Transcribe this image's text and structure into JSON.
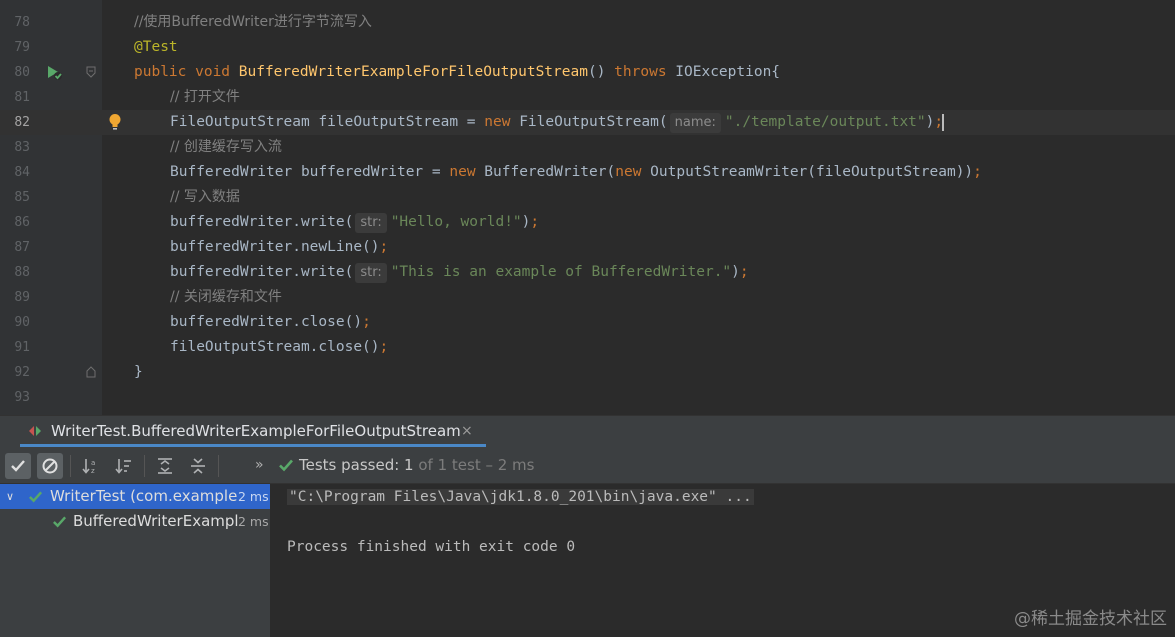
{
  "editor": {
    "lines": [
      {
        "num": "78",
        "parts": [
          {
            "t": "//使用BufferedWriter进行字节流写入",
            "c": "cmt"
          }
        ]
      },
      {
        "num": "79",
        "parts": [
          {
            "t": "@Test",
            "c": "ann"
          }
        ]
      },
      {
        "num": "80",
        "parts": [
          {
            "t": "public void ",
            "c": "kw"
          },
          {
            "t": "BufferedWriterExampleForFileOutputStream",
            "c": "fn"
          },
          {
            "t": "() ",
            "c": ""
          },
          {
            "t": "throws ",
            "c": "kw"
          },
          {
            "t": "IOException{",
            "c": ""
          }
        ]
      },
      {
        "num": "81",
        "parts": [
          {
            "t": "// 打开文件",
            "c": "cmt"
          }
        ]
      },
      {
        "num": "82",
        "parts": [
          {
            "t": "FileOutputStream fileOutputStream = ",
            "c": ""
          },
          {
            "t": "new ",
            "c": "kw"
          },
          {
            "t": "FileOutputStream(",
            "c": ""
          },
          {
            "t": "name:",
            "c": "hint"
          },
          {
            "t": "\"./template/output.txt\"",
            "c": "str"
          },
          {
            "t": ")",
            "c": ""
          },
          {
            "t": ";",
            "c": "kw"
          }
        ]
      },
      {
        "num": "83",
        "parts": [
          {
            "t": "// 创建缓存写入流",
            "c": "cmt"
          }
        ]
      },
      {
        "num": "84",
        "parts": [
          {
            "t": "BufferedWriter bufferedWriter = ",
            "c": ""
          },
          {
            "t": "new ",
            "c": "kw"
          },
          {
            "t": "BufferedWriter(",
            "c": ""
          },
          {
            "t": "new ",
            "c": "kw"
          },
          {
            "t": "OutputStreamWriter(fileOutputStream))",
            "c": ""
          },
          {
            "t": ";",
            "c": "kw"
          }
        ]
      },
      {
        "num": "85",
        "parts": [
          {
            "t": "// 写入数据",
            "c": "cmt"
          }
        ]
      },
      {
        "num": "86",
        "parts": [
          {
            "t": "bufferedWriter.write(",
            "c": ""
          },
          {
            "t": "str:",
            "c": "hint"
          },
          {
            "t": "\"Hello, world!\"",
            "c": "str"
          },
          {
            "t": ")",
            "c": ""
          },
          {
            "t": ";",
            "c": "kw"
          }
        ]
      },
      {
        "num": "87",
        "parts": [
          {
            "t": "bufferedWriter.newLine()",
            "c": ""
          },
          {
            "t": ";",
            "c": "kw"
          }
        ]
      },
      {
        "num": "88",
        "parts": [
          {
            "t": "bufferedWriter.write(",
            "c": ""
          },
          {
            "t": "str:",
            "c": "hint"
          },
          {
            "t": "\"This is an example of BufferedWriter.\"",
            "c": "str"
          },
          {
            "t": ")",
            "c": ""
          },
          {
            "t": ";",
            "c": "kw"
          }
        ]
      },
      {
        "num": "89",
        "parts": [
          {
            "t": "// 关闭缓存和文件",
            "c": "cmt"
          }
        ]
      },
      {
        "num": "90",
        "parts": [
          {
            "t": "bufferedWriter.close()",
            "c": ""
          },
          {
            "t": ";",
            "c": "kw"
          }
        ]
      },
      {
        "num": "91",
        "parts": [
          {
            "t": "fileOutputStream.close()",
            "c": ""
          },
          {
            "t": ";",
            "c": "kw"
          }
        ]
      },
      {
        "num": "92",
        "parts": [
          {
            "t": "}",
            "c": ""
          }
        ]
      },
      {
        "num": "93",
        "parts": []
      }
    ]
  },
  "run_tab": {
    "label": "WriterTest.BufferedWriterExampleForFileOutputStream",
    "close": "×"
  },
  "toolbar": {
    "chevron": "»",
    "status_main": "Tests passed: ",
    "status_count": "1",
    "status_rest": " of 1 test – 2 ms"
  },
  "tree": {
    "root_chevron": "∨",
    "root_name": "WriterTest (com.example",
    "root_time": "2 ms",
    "child_name": "BufferedWriterExampl",
    "child_time": "2 ms"
  },
  "console": {
    "command": "\"C:\\Program Files\\Java\\jdk1.8.0_201\\bin\\java.exe\" ...",
    "exit": "Process finished with exit code 0"
  },
  "watermark": "@稀土掘金技术社区",
  "colors": {
    "background": "#2b2b2b",
    "keyword": "#cc7832",
    "string": "#6a8759",
    "function": "#ffc66d",
    "annotation": "#bbb529",
    "pass_green": "#59a869",
    "selection": "#2f65ca"
  }
}
